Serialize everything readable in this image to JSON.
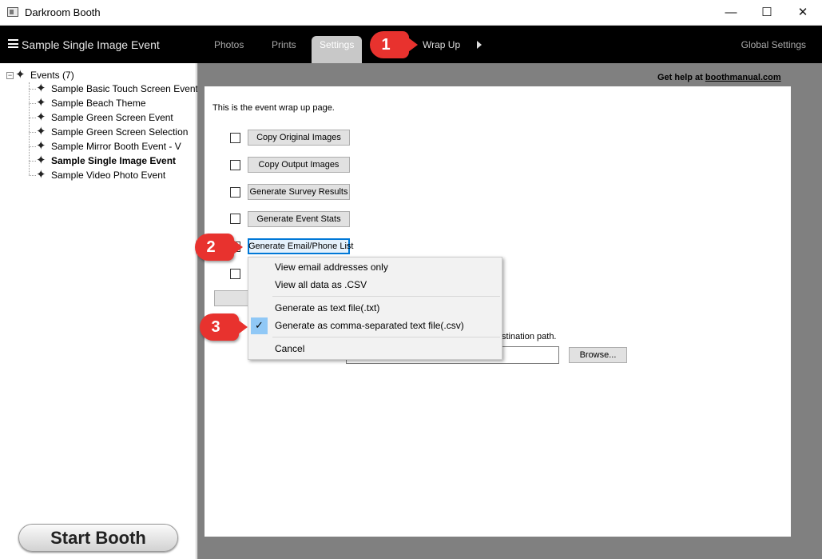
{
  "window": {
    "title": "Darkroom Booth",
    "controls": {
      "minimize": "—",
      "maximize": "☐",
      "close": "✕"
    }
  },
  "navbar": {
    "event_title": "Sample Single Image Event",
    "tabs": [
      {
        "label": "Photos"
      },
      {
        "label": "Prints"
      },
      {
        "label": "Settings",
        "active": true
      },
      {
        "label": "Wrap Up"
      }
    ],
    "global_settings": "Global Settings"
  },
  "tree": {
    "root_label": "Events (7)",
    "expander": "−",
    "items": [
      {
        "label": "Sample Basic Touch Screen Event"
      },
      {
        "label": "Sample Beach Theme"
      },
      {
        "label": "Sample Green Screen Event"
      },
      {
        "label": "Sample Green Screen Selection"
      },
      {
        "label": "Sample Mirror Booth Event - V"
      },
      {
        "label": "Sample Single Image Event",
        "selected": true
      },
      {
        "label": "Sample Video Photo Event"
      }
    ]
  },
  "start_booth": "Start Booth",
  "help": {
    "prefix": "Get help at ",
    "link": "boothmanual.com"
  },
  "main": {
    "intro": "This is the event wrap up page.",
    "actions": [
      {
        "label": "Copy Original Images"
      },
      {
        "label": "Copy Output Images"
      },
      {
        "label": "Generate Survey Results"
      },
      {
        "label": "Generate Event Stats"
      },
      {
        "label": "Generate Email/Phone List"
      }
    ],
    "destination_text": "stination path.",
    "browse": "Browse..."
  },
  "menu": {
    "items": [
      {
        "label": "View email addresses only"
      },
      {
        "label": "View all data as .CSV"
      },
      {
        "label": "Generate as text file(.txt)"
      },
      {
        "label": "Generate as comma-separated text file(.csv)",
        "checked": true
      },
      {
        "label": "Cancel"
      }
    ],
    "check": "✓"
  },
  "callouts": [
    "1",
    "2",
    "3"
  ],
  "colors": {
    "callout": "#e8322e",
    "nav_bg": "#000000",
    "menu_check_bg": "#90c8f6"
  }
}
